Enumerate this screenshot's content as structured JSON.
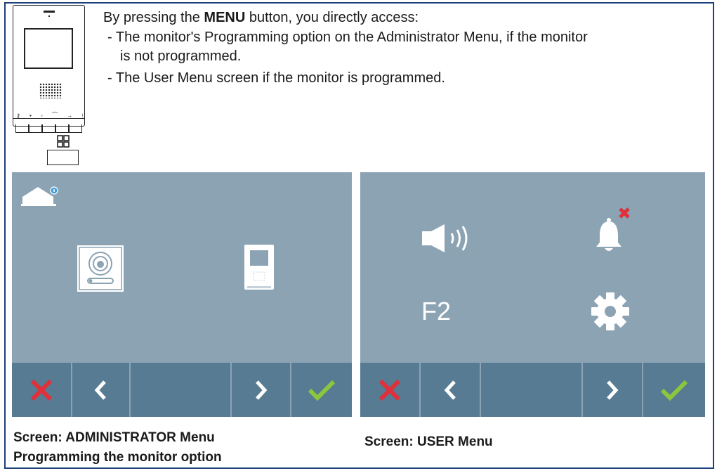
{
  "intro": {
    "lead_before": "By pressing the ",
    "lead_bold": "MENU",
    "lead_after": " button, you directly access:",
    "bullet1_line1": "- The monitor's Programming option on the Administrator Menu, if the monitor",
    "bullet1_line2": "is not programmed.",
    "bullet2": "- The User Menu screen if the monitor is programmed."
  },
  "admin_screen": {
    "icons": [
      "home-info-icon",
      "door-panel-icon",
      "monitor-icon"
    ],
    "navbar": [
      "close-icon",
      "chevron-left-icon",
      "chevron-right-icon",
      "check-icon"
    ]
  },
  "user_screen": {
    "icons": [
      "speaker-volume-icon",
      "bell-muted-icon",
      "settings-gear-icon"
    ],
    "f2_label": "F2",
    "navbar": [
      "close-icon",
      "chevron-left-icon",
      "chevron-right-icon",
      "check-icon"
    ]
  },
  "captions": {
    "admin_line1": "Screen: ADMINISTRATOR Menu",
    "admin_line2": "Programming the monitor option",
    "user": "Screen: USER Menu"
  },
  "colors": {
    "screen_bg": "#8ca3b3",
    "navbar_bg": "#567b92",
    "cancel_red": "#e0303a",
    "confirm_green": "#8cc63f",
    "frame_blue": "#1c3f7a"
  }
}
